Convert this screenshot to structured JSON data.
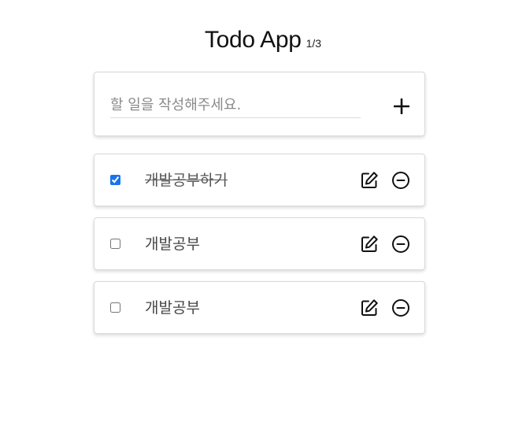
{
  "header": {
    "title": "Todo App",
    "count": "1/3"
  },
  "new_todo": {
    "placeholder": "할 일을 작성해주세요.",
    "value": "",
    "add_icon": "plus-icon"
  },
  "todos": [
    {
      "text": "개발공부하기",
      "checked": true
    },
    {
      "text": "개발공부",
      "checked": false
    },
    {
      "text": "개발공부",
      "checked": false
    }
  ],
  "icons": {
    "edit": "edit-icon",
    "delete": "minus-circle-icon"
  },
  "colors": {
    "checkbox_accent": "#1a73e8",
    "text": "#444444",
    "border": "#d9d9d9"
  }
}
